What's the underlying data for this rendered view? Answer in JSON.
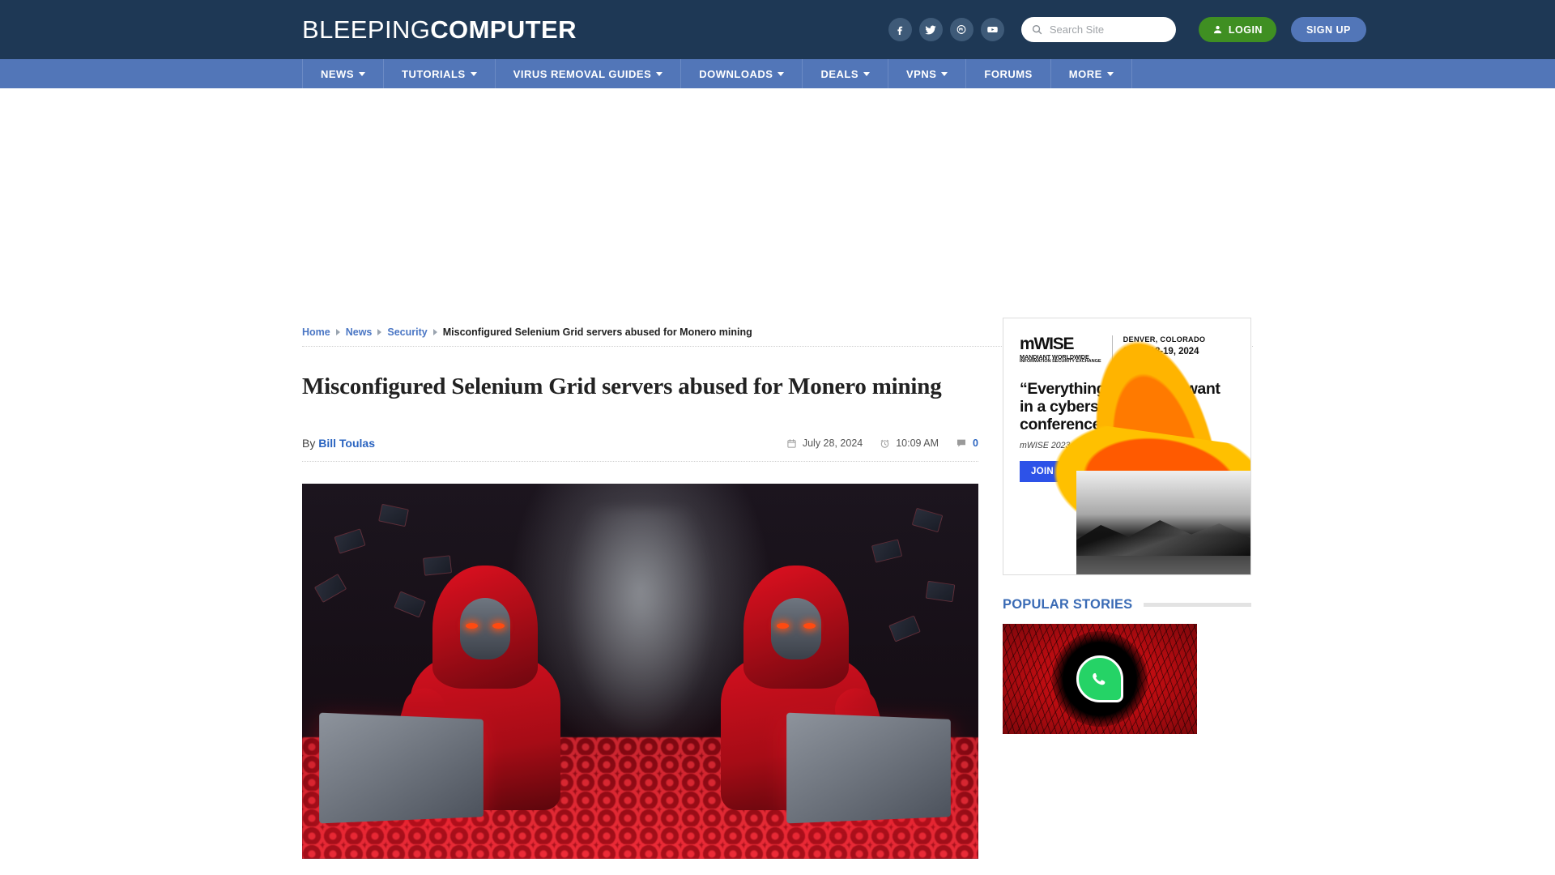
{
  "header": {
    "logo_light": "BLEEPING",
    "logo_bold": "COMPUTER",
    "social": [
      {
        "name": "facebook-icon",
        "label": "Facebook"
      },
      {
        "name": "twitter-icon",
        "label": "Twitter"
      },
      {
        "name": "mastodon-icon",
        "label": "Mastodon"
      },
      {
        "name": "youtube-icon",
        "label": "YouTube"
      }
    ],
    "search_placeholder": "Search Site",
    "search_value": "",
    "login_label": "LOGIN",
    "signup_label": "SIGN UP",
    "bg_color": "#1e3855",
    "login_color": "#3f8f22",
    "signup_color": "#5276b8"
  },
  "nav": {
    "bg_color": "#5276b8",
    "items": [
      {
        "label": "NEWS",
        "has_dropdown": true
      },
      {
        "label": "TUTORIALS",
        "has_dropdown": true
      },
      {
        "label": "VIRUS REMOVAL GUIDES",
        "has_dropdown": true
      },
      {
        "label": "DOWNLOADS",
        "has_dropdown": true
      },
      {
        "label": "DEALS",
        "has_dropdown": true
      },
      {
        "label": "VPNS",
        "has_dropdown": true
      },
      {
        "label": "FORUMS",
        "has_dropdown": false
      },
      {
        "label": "MORE",
        "has_dropdown": true
      }
    ]
  },
  "breadcrumb": {
    "items": [
      {
        "label": "Home",
        "current": false
      },
      {
        "label": "News",
        "current": false
      },
      {
        "label": "Security",
        "current": false
      },
      {
        "label": "Misconfigured Selenium Grid servers abused for Monero mining",
        "current": true
      }
    ]
  },
  "article": {
    "title": "Misconfigured Selenium Grid servers abused for Monero mining",
    "by_word": "By",
    "author": "Bill Toulas",
    "date": "July 28, 2024",
    "time": "10:09 AM",
    "comment_count": "0",
    "image_alt": "Two hooded hackers in red hoodies with masks typing on laptops over glowing red coins"
  },
  "sidebar": {
    "ad": {
      "brand": "mWISE",
      "brand_sub1": "MANDIANT WORLDWIDE",
      "brand_sub2": "INFORMATION SECURITY EXCHANGE",
      "city": "DENVER, COLORADO",
      "date": "SEPT 18-19, 2024",
      "quote": "“Everything you could want in a cybersecurity conference.”",
      "attribution": "mWISE 2023 Attendee",
      "cta_label": "JOIN US IN DENVER",
      "cta_color": "#2d52e8"
    },
    "popular": {
      "title": "POPULAR STORIES",
      "story_thumb_alt": "WhatsApp logo on a red cracked background"
    }
  }
}
